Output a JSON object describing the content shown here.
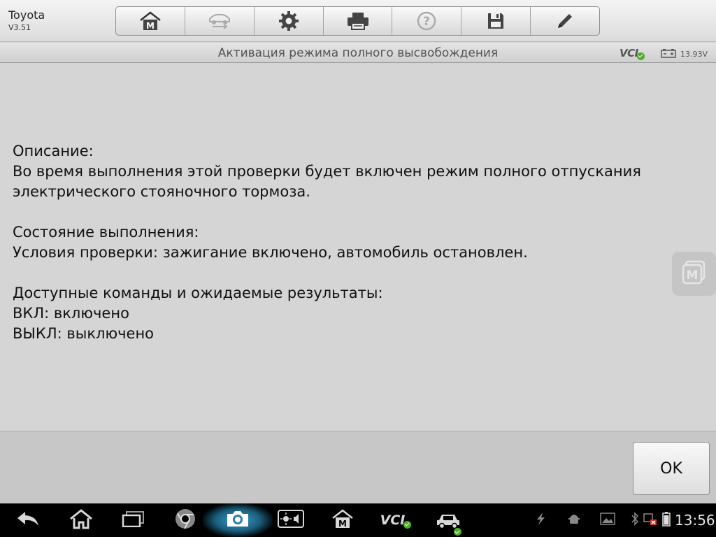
{
  "vehicle": {
    "name": "Toyota",
    "version": "V3.51"
  },
  "toolbar": {
    "items": [
      {
        "icon": "home-m-icon"
      },
      {
        "icon": "vehicle-swap-icon"
      },
      {
        "icon": "gear-icon"
      },
      {
        "icon": "printer-icon"
      },
      {
        "icon": "help-icon"
      },
      {
        "icon": "save-icon"
      },
      {
        "icon": "pen-icon"
      }
    ]
  },
  "titlebar": {
    "title": "Активация режима полного высвобождения",
    "vci_label": "VCI",
    "battery_voltage": "13.93V"
  },
  "content": {
    "lines": [
      "Описание:",
      "Во время выполнения этой проверки будет включен режим полного отпускания",
      "электрического стояночного тормоза.",
      "",
      "Состояние выполнения:",
      "Условия проверки: зажигание включено, автомобиль остановлен.",
      "",
      "Доступные команды и ожидаемые результаты:",
      "ВКЛ: включено",
      "ВЫКЛ: выключено"
    ]
  },
  "floating_button": {
    "icon": "maxisys-m-icon",
    "label": "M"
  },
  "actionbar": {
    "ok_label": "OK"
  },
  "navbar": {
    "clock": "13:56",
    "vci_label": "VCI",
    "icons": [
      "back-icon",
      "home-icon",
      "recent-apps-icon",
      "chrome-icon",
      "camera-icon",
      "display-settings-icon",
      "maxisys-home-icon",
      "vci-icon",
      "car-icon"
    ]
  },
  "colors": {
    "status_green": "#4caf28",
    "background": "#d5d5d5"
  }
}
